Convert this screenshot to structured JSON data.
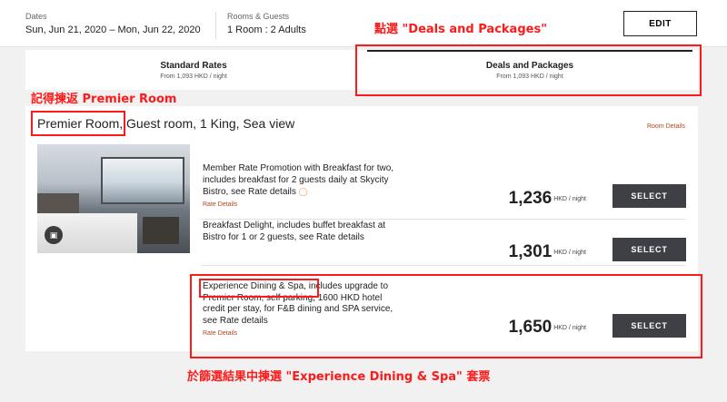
{
  "search": {
    "dates_label": "Dates",
    "dates_value": "Sun, Jun 21, 2020 – Mon, Jun 22, 2020",
    "guests_label": "Rooms & Guests",
    "guests_value": "1 Room : 2 Adults",
    "edit_label": "EDIT"
  },
  "tabs": [
    {
      "title": "Standard Rates",
      "sub": "From 1,093 HKD / night",
      "active": false
    },
    {
      "title": "Deals and Packages",
      "sub": "From 1,093 HKD / night",
      "active": true
    }
  ],
  "room": {
    "name": "Premier Room",
    "description": ", Guest room, 1 King, Sea view",
    "details_link": "Room Details"
  },
  "rates": [
    {
      "description": "Member Rate Promotion with Breakfast for two, includes breakfast for 2 guests daily at Skycity Bistro, see Rate details",
      "details_link": "Rate Details",
      "price": "1,236",
      "unit": "HKD / night",
      "select": "SELECT",
      "icon": "tag-icon"
    },
    {
      "description": "Breakfast Delight, includes buffet breakfast at Bistro for 1 or 2 guests, see Rate details",
      "details_link": "",
      "price": "1,301",
      "unit": "HKD / night",
      "select": "SELECT"
    },
    {
      "description": "Experience Dining & Spa, includes upgrade to Premier Room, self parking, 1600 HKD hotel credit per stay, for F&B dining and SPA service, see Rate details",
      "details_link": "Rate Details",
      "price": "1,650",
      "unit": "HKD / night",
      "select": "SELECT"
    }
  ],
  "annotations": {
    "deals_hint": "點選 \"Deals and Packages\"",
    "room_hint": "記得揀返 Premier Room",
    "package_hint": "於篩選結果中揀選 \"Experience Dining & Spa\" 套票",
    "color": "#ff1a1a"
  }
}
